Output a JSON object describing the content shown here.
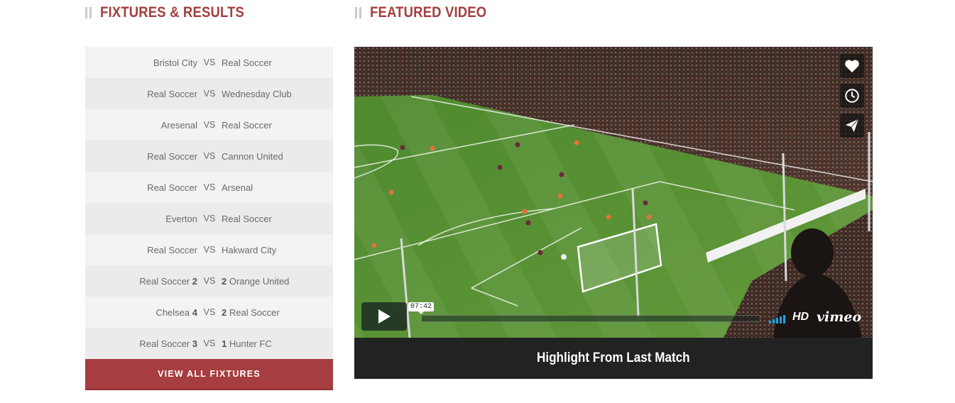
{
  "fixtures_section": {
    "title": "FIXTURES & RESULTS",
    "vs_label": "VS",
    "rows": [
      {
        "home": "Bristol City",
        "home_score": "",
        "away": "Real Soccer",
        "away_score": ""
      },
      {
        "home": "Real Soccer",
        "home_score": "",
        "away": "Wednesday Club",
        "away_score": ""
      },
      {
        "home": "Aresenal",
        "home_score": "",
        "away": "Real Soccer",
        "away_score": ""
      },
      {
        "home": "Real Soccer",
        "home_score": "",
        "away": "Cannon United",
        "away_score": ""
      },
      {
        "home": "Real Soccer",
        "home_score": "",
        "away": "Arsenal",
        "away_score": ""
      },
      {
        "home": "Everton",
        "home_score": "",
        "away": "Real Soccer",
        "away_score": ""
      },
      {
        "home": "Real Soccer",
        "home_score": "",
        "away": "Hakward City",
        "away_score": ""
      },
      {
        "home": "Real Soccer",
        "home_score": "2",
        "away": "Orange United",
        "away_score": "2"
      },
      {
        "home": "Chelsea",
        "home_score": "4",
        "away": "Real Soccer",
        "away_score": "2"
      },
      {
        "home": "Real Soccer",
        "home_score": "3",
        "away": "Hunter FC",
        "away_score": "1"
      }
    ],
    "button_label": "VIEW ALL FIXTURES"
  },
  "video_section": {
    "title": "FEATURED VIDEO",
    "player": {
      "time_label": "07:42",
      "hd_label": "HD",
      "brand_label": "vimeo",
      "side_buttons": [
        "heart-icon",
        "clock-icon",
        "send-icon"
      ]
    },
    "caption": "Highlight From Last Match"
  },
  "colors": {
    "accent": "#a63d40",
    "title": "#a33f3f",
    "row_light": "#f3f3f3",
    "row_dark": "#ebebeb",
    "caption_bg": "#222222",
    "volume": "#17a6e8"
  }
}
